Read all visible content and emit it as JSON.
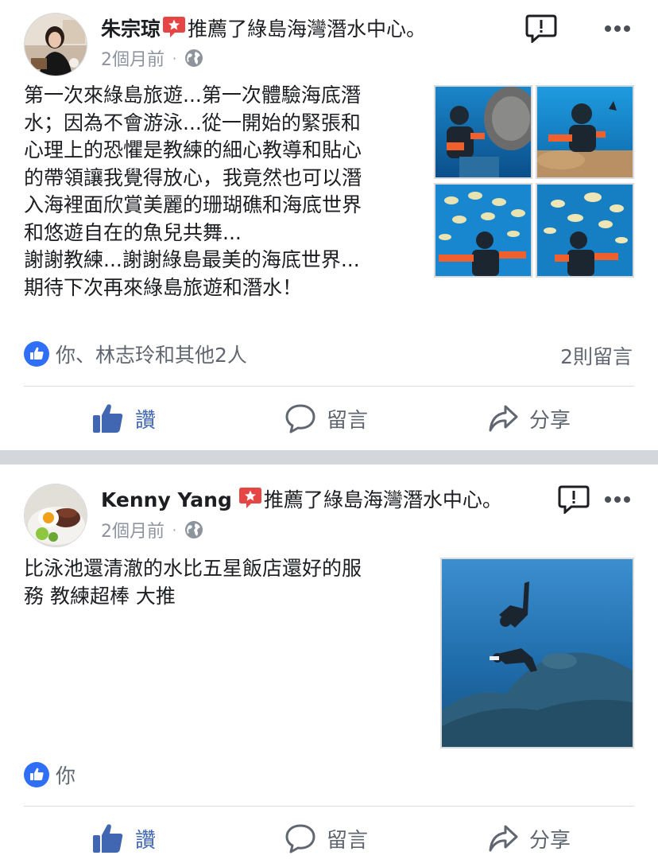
{
  "posts": [
    {
      "author": "朱宗琼",
      "action": "推薦了綠島海灣潛水中心。",
      "time": "2個月前",
      "dot": "·",
      "text": "第一次來綠島旅遊...第一次體驗海底潛\n水；因為不會游泳...從一開始的緊張和\n心理上的恐懼是教練的細心教導和貼心\n的帶領讓我覺得放心，我竟然也可以潛\n入海裡面欣賞美麗的珊瑚礁和海底世界\n和悠遊自在的魚兒共舞...\n謝謝教練...謝謝綠島最美的海底世界...\n期待下次再來綠島旅遊和潛水！",
      "reactions": "你、林志玲和其他2人",
      "comments": "2則留言",
      "actions": {
        "like": "讚",
        "comment": "留言",
        "share": "分享"
      }
    },
    {
      "author": "Kenny Yang",
      "action": "推薦了綠島海灣潛水中心。",
      "time": "2個月前",
      "dot": "·",
      "text": "比泳池還清澈的水比五星飯店還好的服\n務 教練超棒 大推",
      "reactions": "你",
      "actions": {
        "like": "讚",
        "comment": "留言",
        "share": "分享"
      }
    }
  ],
  "colors": {
    "brand_blue": "#4267b2",
    "like_blue": "#2f6ff5",
    "recommend_red": "#e64545",
    "secondary_text": "#606770",
    "separator": "#d3d6da"
  },
  "icons": [
    "recommend-star-icon",
    "globe-icon",
    "report-icon",
    "more-icon",
    "like-badge-icon",
    "thumbs-up-icon",
    "comment-icon",
    "share-icon"
  ]
}
